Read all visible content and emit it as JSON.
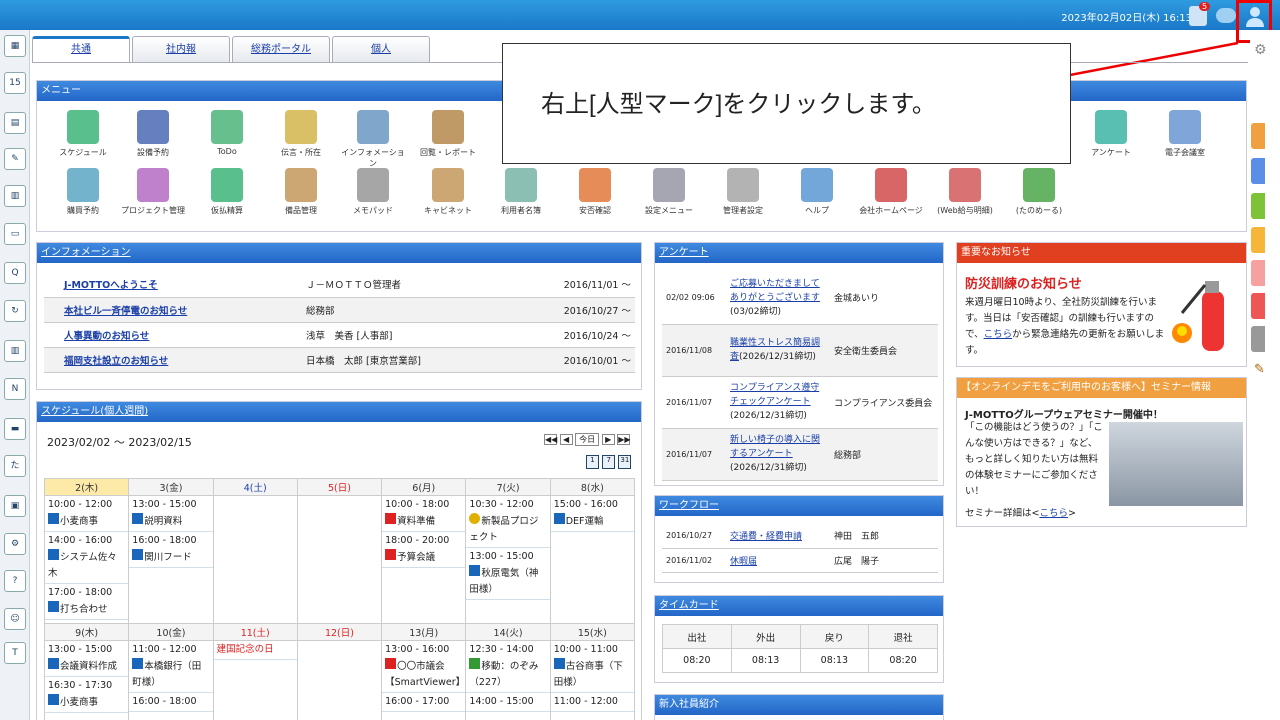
{
  "topbar": {
    "datetime": "2023年02月02日(木) 16:13",
    "notification_count": "5"
  },
  "tabs": [
    {
      "label": "共通"
    },
    {
      "label": "社内報"
    },
    {
      "label": "総務ポータル"
    },
    {
      "label": "個人"
    }
  ],
  "menu": {
    "title": "メニュー",
    "items": [
      {
        "label": "スケジュール"
      },
      {
        "label": "設備予約"
      },
      {
        "label": "ToDo"
      },
      {
        "label": "伝言・所在"
      },
      {
        "label": "インフォメーション"
      },
      {
        "label": "回覧・レポート"
      },
      {
        "label": "アンケート"
      },
      {
        "label": "電子会議室"
      },
      {
        "label": "購買予約"
      },
      {
        "label": "プロジェクト管理"
      },
      {
        "label": "仮払精算"
      },
      {
        "label": "備品管理"
      },
      {
        "label": "メモパッド"
      },
      {
        "label": "キャビネット"
      },
      {
        "label": "利用者名簿"
      },
      {
        "label": "安否確認"
      },
      {
        "label": "設定メニュー"
      },
      {
        "label": "管理者設定"
      },
      {
        "label": "ヘルプ"
      },
      {
        "label": "会社ホームページ"
      },
      {
        "label": "(Web給与明細)"
      },
      {
        "label": "(たのめーる)"
      }
    ]
  },
  "callout": {
    "text": "右上[人型マーク]をクリックします。"
  },
  "information": {
    "title": "インフォメーション",
    "rows": [
      {
        "title": "J-MOTTOへようこそ",
        "author": "Ｊ－ＭＯＴＴＯ管理者",
        "date": "2016/11/01 ～"
      },
      {
        "title": "本社ビル一斉停電のお知らせ",
        "author": "総務部",
        "date": "2016/10/27 ～"
      },
      {
        "title": "人事異動のお知らせ",
        "author": "浅草　美香 [人事部]",
        "date": "2016/10/24 ～"
      },
      {
        "title": "福岡支社設立のお知らせ",
        "author": "日本橋　太郎 [東京営業部]",
        "date": "2016/10/01 ～"
      }
    ]
  },
  "schedule": {
    "title": "スケジュール(個人週間)",
    "range": "2023/02/02 ～ 2023/02/15",
    "today_label": "今日",
    "week1_days": [
      "2(木)",
      "3(金)",
      "4(土)",
      "5(日)",
      "6(月)",
      "7(火)",
      "8(水)"
    ],
    "week2_days": [
      "9(木)",
      "10(金)",
      "11(土)",
      "12(日)",
      "13(月)",
      "14(火)",
      "15(水)"
    ],
    "w1": {
      "d0": [
        {
          "t": "10:00 - 12:00",
          "n": "小麦商事"
        },
        {
          "t": "14:00 - 16:00",
          "n": "システム佐々木"
        },
        {
          "t": "17:00 - 18:00",
          "n": "打ち合わせ"
        }
      ],
      "d1": [
        {
          "t": "13:00 - 15:00",
          "n": "説明資料"
        },
        {
          "t": "16:00 - 18:00",
          "n": "関川フード"
        }
      ],
      "d4": [
        {
          "t": "10:00 - 18:00",
          "n": "資料準備"
        },
        {
          "t": "18:00 - 20:00",
          "n": "予算会議"
        }
      ],
      "d5": [
        {
          "t": "10:30 - 12:00",
          "n": "新製品プロジェクト"
        },
        {
          "t": "13:00 - 15:00",
          "n": "秋原電気（神田様）"
        }
      ],
      "d6": [
        {
          "t": "15:00 - 16:00",
          "n": "DEF運輸"
        }
      ]
    },
    "w2": {
      "d0": [
        {
          "t": "13:00 - 15:00",
          "n": "会議資料作成"
        },
        {
          "t": "16:30 - 17:30",
          "n": "小麦商事"
        }
      ],
      "d1": [
        {
          "t": "11:00 - 12:00",
          "n": "本橋銀行（田町様）"
        },
        {
          "t": "16:00 - 18:00",
          "n": ""
        }
      ],
      "d2": [
        {
          "t": "",
          "n": "建国記念の日"
        }
      ],
      "d4": [
        {
          "t": "13:00 - 16:00",
          "n": "〇〇市議会【SmartViewer】"
        },
        {
          "t": "16:00 - 17:00",
          "n": ""
        }
      ],
      "d5": [
        {
          "t": "12:30 - 14:00",
          "n": "移動：のぞみ（227）"
        },
        {
          "t": "14:00 - 15:00",
          "n": ""
        }
      ],
      "d6": [
        {
          "t": "10:00 - 11:00",
          "n": "古谷商事（下田様）"
        },
        {
          "t": "11:00 - 12:00",
          "n": ""
        }
      ]
    }
  },
  "survey": {
    "title": "アンケート",
    "rows": [
      {
        "date": "02/02 09:06",
        "title": "ご応募いただきましてありがとうございます",
        "sub": "(03/02締切)",
        "author": "金城あいり"
      },
      {
        "date": "2016/11/08",
        "title": "職業性ストレス簡易調査",
        "sub": "(2026/12/31締切)",
        "author": "安全衛生委員会"
      },
      {
        "date": "2016/11/07",
        "title": "コンプライアンス遵守チェックアンケート",
        "sub": "(2026/12/31締切)",
        "author": "コンプライアンス委員会"
      },
      {
        "date": "2016/11/07",
        "title": "新しい椅子の導入に関するアンケート",
        "sub": "(2026/12/31締切)",
        "author": "総務部"
      }
    ]
  },
  "workflow": {
    "title": "ワークフロー",
    "rows": [
      {
        "date": "2016/10/27",
        "title": "交通費・経費申請",
        "author": "神田　五郎"
      },
      {
        "date": "2016/11/02",
        "title": "休暇届",
        "author": "広尾　陽子"
      }
    ]
  },
  "timecard": {
    "title": "タイムカード",
    "headers": [
      "出社",
      "外出",
      "戻り",
      "退社"
    ],
    "values": [
      "08:20",
      "08:13",
      "08:13",
      "08:20"
    ]
  },
  "newstaff": {
    "title": "新入社員紹介"
  },
  "notice": {
    "title": "重要なお知らせ",
    "headline": "防災訓練のお知らせ",
    "body1": "来週月曜日10時より、全社防災訓練を行います。当日は「安否確認」の訓練も行いますので、",
    "link": "こちら",
    "body2": "から緊急連絡先の更新をお願いします。"
  },
  "seminar": {
    "title": "【オンラインデモをご利用中のお客様へ】セミナー情報",
    "headline": "J-MOTTOグループウェアセミナー開催中！",
    "body": "「この機能はどう使うの？」「こんな使い方はできる？」など、もっと詳しく知りたい方は無料の体験セミナーにご参加ください！",
    "detail_prefix": "セミナー詳細は<",
    "detail_link": "こちら",
    "detail_suffix": ">"
  },
  "colors": {
    "accent": "#1a78c8",
    "highlight": "#ee0000"
  }
}
